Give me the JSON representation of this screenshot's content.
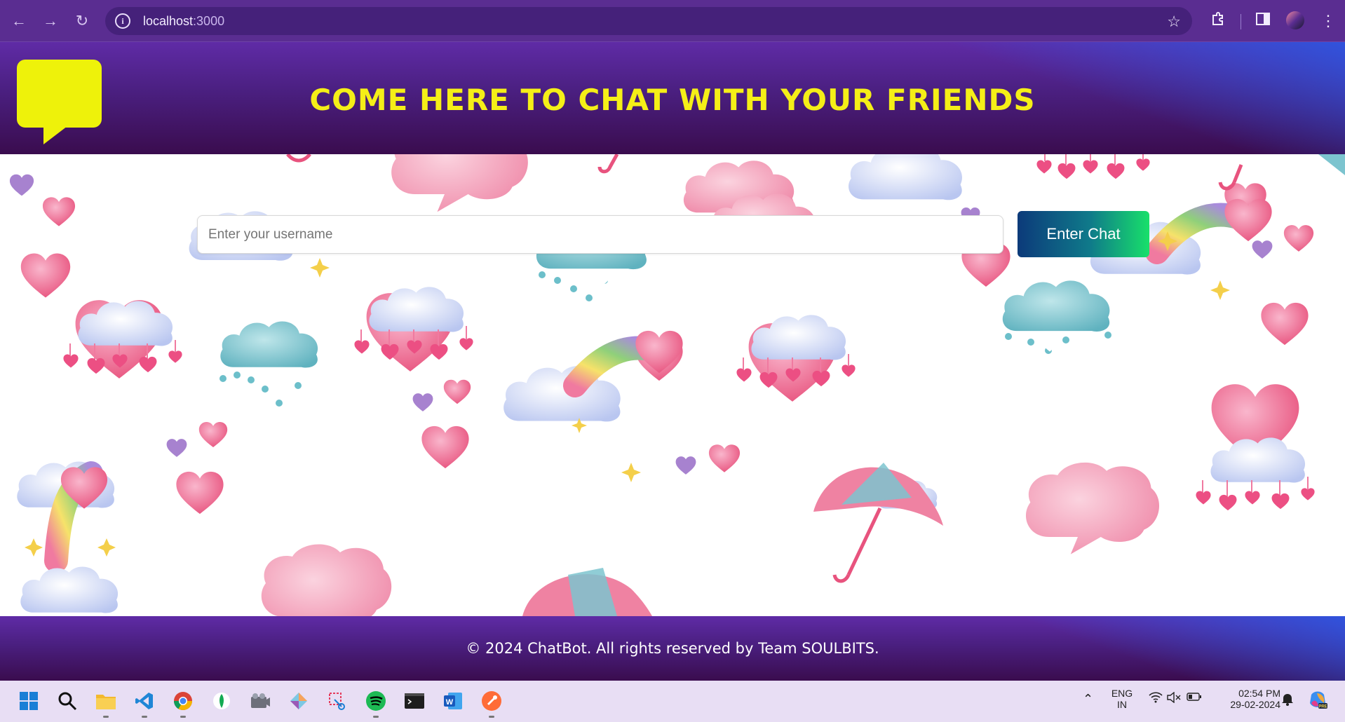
{
  "browser": {
    "url_host": "localhost",
    "url_port": ":3000",
    "back_icon": "arrow-left-icon",
    "forward_icon": "arrow-right-icon",
    "reload_icon": "reload-icon"
  },
  "header": {
    "title": "COME HERE TO CHAT WITH YOUR FRIENDS",
    "logo": "chat-bubble-logo",
    "logo_color": "#eef20a",
    "title_color": "#f5ef17"
  },
  "form": {
    "username_placeholder": "Enter your username",
    "username_value": "",
    "button_label": "Enter Chat"
  },
  "footer": {
    "text": "© 2024 ChatBot. All rights reserved by Team SOULBITS."
  },
  "taskbar": {
    "apps": [
      "start-icon",
      "search-icon",
      "file-explorer-icon",
      "vscode-icon",
      "chrome-icon",
      "mongodb-icon",
      "camera-icon",
      "git-icon",
      "snipping-tool-icon",
      "spotify-icon",
      "terminal-icon",
      "word-icon",
      "postman-icon"
    ],
    "lang_line1": "ENG",
    "lang_line2": "IN",
    "time": "02:54 PM",
    "date": "29-02-2024"
  },
  "colors": {
    "accent_purple": "#5a2d91",
    "button_start": "#0c3a7a",
    "button_end": "#18e06a"
  }
}
